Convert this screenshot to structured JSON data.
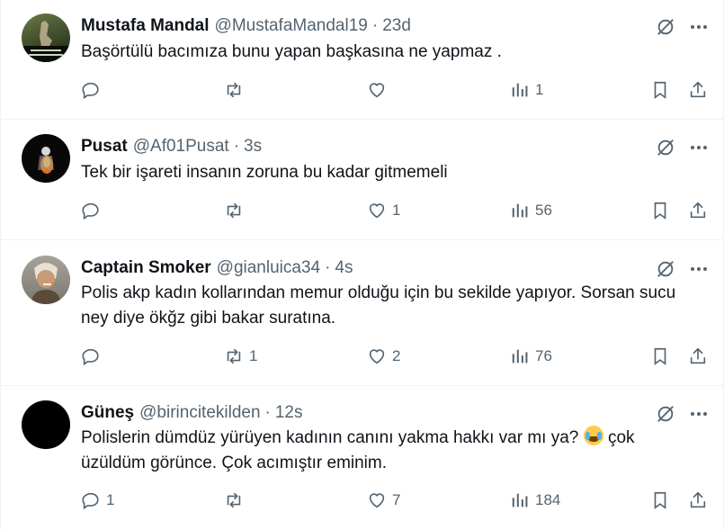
{
  "replies": [
    {
      "name": "Mustafa Mandal",
      "handle": "@MustafaMandal19",
      "time": "23d",
      "text": "Başörtülü bacımıza bunu yapan başkasına ne yapmaz .",
      "replies": "",
      "reposts": "",
      "likes": "",
      "views": "1"
    },
    {
      "name": "Pusat",
      "handle": "@Af01Pusat",
      "time": "3s",
      "text": "Tek bir işareti insanın zoruna bu kadar gitmemeli",
      "replies": "",
      "reposts": "",
      "likes": "1",
      "views": "56"
    },
    {
      "name": "Captain Smoker",
      "handle": "@gianluica34",
      "time": "4s",
      "text": "Polis akp kadın kollarından memur olduğu için bu sekilde yapıyor. Sorsan sucu ney diye ökğz gibi bakar suratına.",
      "replies": "",
      "reposts": "1",
      "likes": "2",
      "views": "76"
    },
    {
      "name": "Güneş",
      "handle": "@birincitekilden",
      "time": "12s",
      "text_before": "Polislerin dümdüz yürüyen kadının canını yakma hakkı var mı ya?",
      "text_after": "çok üzüldüm görünce. Çok acımıştır eminim.",
      "emoji": "loudly-crying-face",
      "replies": "1",
      "reposts": "",
      "likes": "7",
      "views": "184"
    }
  ],
  "separator": "·",
  "colors": {
    "text": "#0f1419",
    "secondary": "#536471",
    "border": "#eff3f4"
  },
  "icons": [
    "grok-icon",
    "more-icon",
    "reply-icon",
    "repost-icon",
    "like-icon",
    "views-icon",
    "bookmark-icon",
    "share-icon"
  ]
}
